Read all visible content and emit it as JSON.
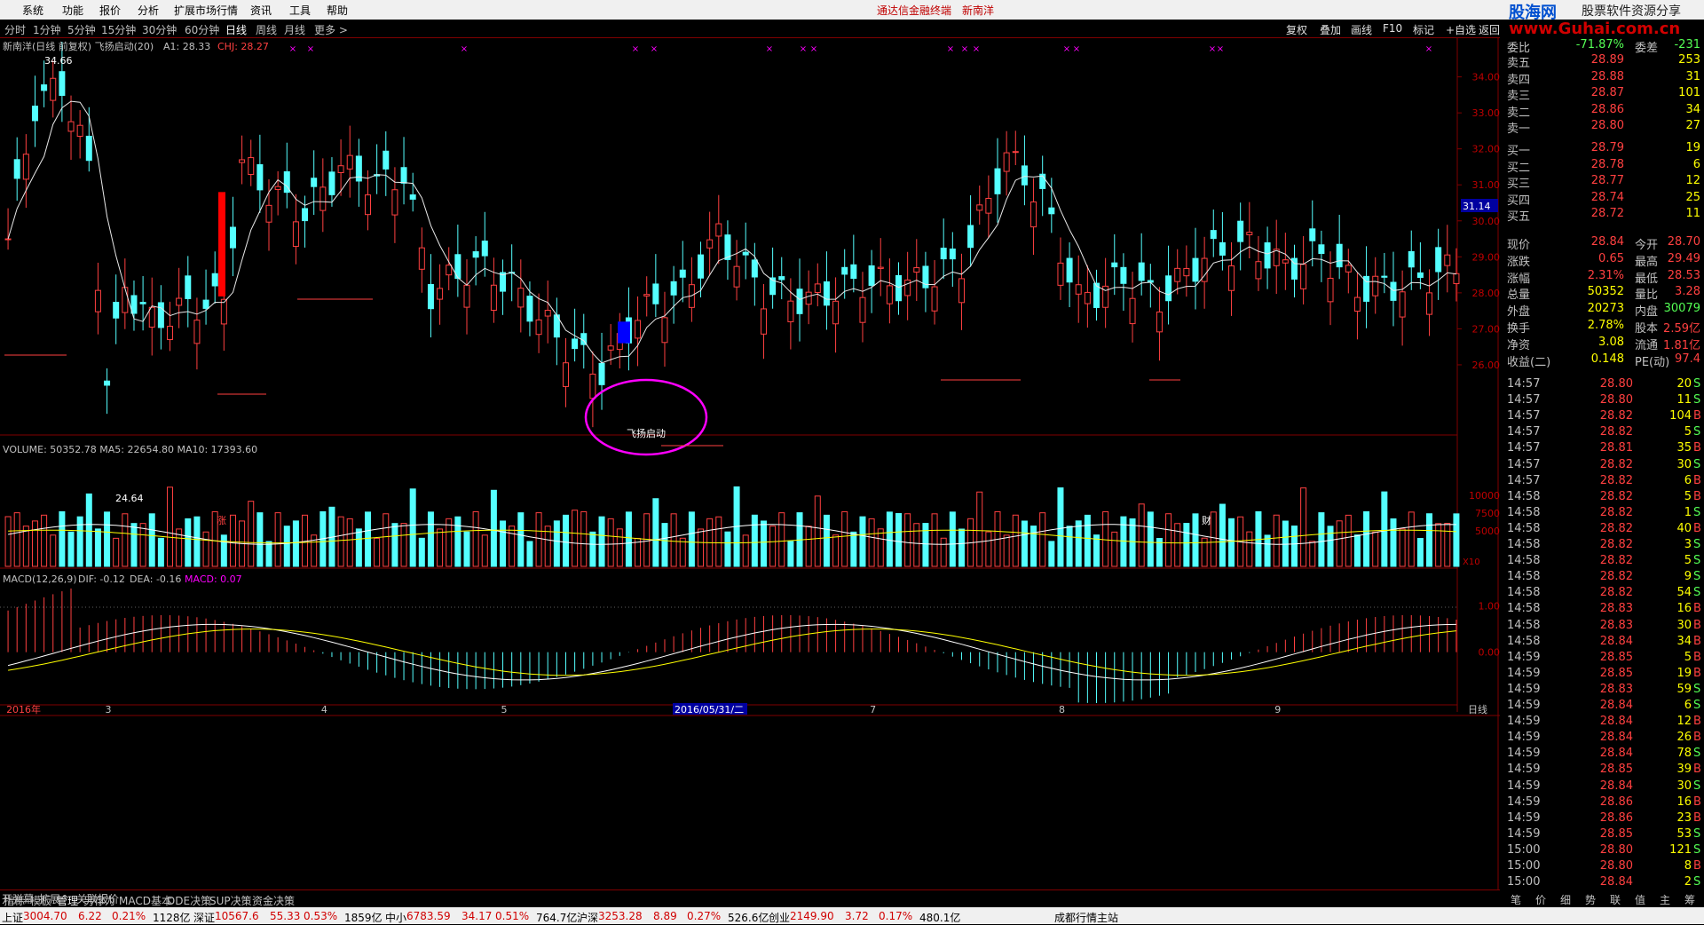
{
  "menu": [
    "系统",
    "功能",
    "报价",
    "分析",
    "扩展市场行情",
    "资讯",
    "工具",
    "帮助"
  ],
  "app_title": "通达信金融终端",
  "stock_title": "新南洋",
  "brand": {
    "name1": "股海网",
    "name2": "股票软件资源分享",
    "url": "www.Guhai.com.cn"
  },
  "periods": [
    "分时",
    "1分钟",
    "5分钟",
    "15分钟",
    "30分钟",
    "60分钟",
    "日线",
    "周线",
    "月线",
    "更多 >"
  ],
  "active_period": "日线",
  "toolbar": [
    "复权",
    "叠加",
    "画线",
    "F10",
    "标记",
    "+自选",
    "返回"
  ],
  "indicator_title": {
    "main": "新南洋(日线 前复权) 飞扬启动(20)",
    "a1": "A1: 28.33",
    "chj": "CHJ: 28.27",
    "volume": "VOLUME: 50352.78  MA5: 22654.80  MA10: 17393.60",
    "macd_name": "MACD(12,26,9)",
    "macd_dif": "DIF: -0.12",
    "macd_dea": "DEA: -0.16",
    "macd_val": "MACD: 0.07"
  },
  "annotations": {
    "high": "34.66",
    "low": "24.64",
    "signal": "飞扬启动",
    "zhang": "涨",
    "cai": "财",
    "x10": "X10",
    "crosshair_price": "31.14",
    "cursor_date": "2016/05/31/二",
    "rix": "日线"
  },
  "chart_data": [
    {
      "type": "candlestick",
      "price_axis": {
        "ticks": [
          34.0,
          33.0,
          32.0,
          31.0,
          30.0,
          29.0,
          28.0,
          27.0,
          26.0
        ],
        "range": [
          24.1,
          35.1
        ]
      },
      "x_axis_labels": [
        {
          "label": "2016年",
          "index": 0
        },
        {
          "label": "3",
          "index": 11
        },
        {
          "label": "4",
          "index": 35
        },
        {
          "label": "5",
          "index": 55
        },
        {
          "label": "6",
          "index": 75
        },
        {
          "label": "7",
          "index": 96
        },
        {
          "label": "8",
          "index": 117
        },
        {
          "label": "9",
          "index": 141
        }
      ],
      "high": 34.66,
      "low": 24.64
    },
    {
      "type": "bar",
      "name": "VOLUME",
      "axis_ticks": [
        10000,
        7500,
        5000
      ],
      "range": [
        0,
        17500
      ]
    },
    {
      "type": "bar",
      "name": "MACD",
      "axis_ticks": [
        1.0,
        0.0
      ],
      "range": [
        -1.1,
        1.7
      ]
    }
  ],
  "quote": {
    "wei": {
      "label": "委比",
      "val": "-71.87%",
      "label2": "委差",
      "val2": "-231"
    },
    "sell": [
      {
        "l": "卖五",
        "p": "28.89",
        "v": "253"
      },
      {
        "l": "卖四",
        "p": "28.88",
        "v": "31"
      },
      {
        "l": "卖三",
        "p": "28.87",
        "v": "101"
      },
      {
        "l": "卖二",
        "p": "28.86",
        "v": "34"
      },
      {
        "l": "卖一",
        "p": "28.80",
        "v": "27"
      }
    ],
    "buy": [
      {
        "l": "买一",
        "p": "28.79",
        "v": "19"
      },
      {
        "l": "买二",
        "p": "28.78",
        "v": "6"
      },
      {
        "l": "买三",
        "p": "28.77",
        "v": "12"
      },
      {
        "l": "买四",
        "p": "28.74",
        "v": "25"
      },
      {
        "l": "买五",
        "p": "28.72",
        "v": "11"
      }
    ],
    "stats": [
      [
        "现价",
        "28.84",
        "今开",
        "28.70"
      ],
      [
        "涨跌",
        "0.65",
        "最高",
        "29.49"
      ],
      [
        "涨幅",
        "2.31%",
        "最低",
        "28.53"
      ],
      [
        "总量",
        "50352",
        "量比",
        "3.28"
      ],
      [
        "外盘",
        "20273",
        "内盘",
        "30079"
      ],
      [
        "换手",
        "2.78%",
        "股本",
        "2.59亿"
      ],
      [
        "净资",
        "3.08",
        "流通",
        "1.81亿"
      ],
      [
        "收益(二)",
        "0.148",
        "PE(动)",
        "97.4"
      ]
    ],
    "ticks": [
      [
        "14:57",
        "28.80",
        "20",
        "S"
      ],
      [
        "14:57",
        "28.80",
        "11",
        "S"
      ],
      [
        "14:57",
        "28.82",
        "104",
        "B"
      ],
      [
        "14:57",
        "28.82",
        "5",
        "S"
      ],
      [
        "14:57",
        "28.81",
        "35",
        "B"
      ],
      [
        "14:57",
        "28.82",
        "30",
        "S"
      ],
      [
        "14:57",
        "28.82",
        "6",
        "B"
      ],
      [
        "14:58",
        "28.82",
        "5",
        "B"
      ],
      [
        "14:58",
        "28.82",
        "1",
        "S"
      ],
      [
        "14:58",
        "28.82",
        "40",
        "B"
      ],
      [
        "14:58",
        "28.82",
        "3",
        "S"
      ],
      [
        "14:58",
        "28.82",
        "5",
        "S"
      ],
      [
        "14:58",
        "28.82",
        "9",
        "S"
      ],
      [
        "14:58",
        "28.82",
        "54",
        "S"
      ],
      [
        "14:58",
        "28.83",
        "16",
        "B"
      ],
      [
        "14:58",
        "28.83",
        "30",
        "B"
      ],
      [
        "14:58",
        "28.84",
        "34",
        "B"
      ],
      [
        "14:59",
        "28.85",
        "5",
        "B"
      ],
      [
        "14:59",
        "28.85",
        "19",
        "B"
      ],
      [
        "14:59",
        "28.83",
        "59",
        "S"
      ],
      [
        "14:59",
        "28.84",
        "6",
        "S"
      ],
      [
        "14:59",
        "28.84",
        "12",
        "B"
      ],
      [
        "14:59",
        "28.84",
        "26",
        "B"
      ],
      [
        "14:59",
        "28.84",
        "78",
        "S"
      ],
      [
        "14:59",
        "28.85",
        "39",
        "B"
      ],
      [
        "14:59",
        "28.84",
        "30",
        "S"
      ],
      [
        "14:59",
        "28.86",
        "16",
        "B"
      ],
      [
        "14:59",
        "28.86",
        "23",
        "B"
      ],
      [
        "14:59",
        "28.85",
        "53",
        "S"
      ],
      [
        "15:00",
        "28.80",
        "121",
        "S"
      ],
      [
        "15:00",
        "28.80",
        "8",
        "B"
      ],
      [
        "15:00",
        "28.84",
        "2",
        "S"
      ]
    ]
  },
  "bottom_tabs": [
    "指标",
    "模板",
    "管理",
    "另存为",
    "MACD基本",
    "DDE决策",
    "SUP决策",
    "资金决策"
  ],
  "bottom_tabs2": [
    "开弹幕",
    "扩展^",
    "关联报价"
  ],
  "quote_tabs": [
    "笔",
    "价",
    "细",
    "势",
    "联",
    "值",
    "主",
    "筹"
  ],
  "status": [
    {
      "n": "上证",
      "v": "3004.70",
      "c": "6.22",
      "p": "0.21%",
      "a": "1128亿"
    },
    {
      "n": "深证",
      "v": "10567.6",
      "c": "55.33",
      "p": "0.53%",
      "a": "1859亿"
    },
    {
      "n": "中小",
      "v": "6783.59",
      "c": "34.17",
      "p": "0.51%",
      "a": "764.7亿"
    },
    {
      "n": "沪深",
      "v": "3253.28",
      "c": "8.89",
      "p": "0.27%",
      "a": "526.6亿"
    },
    {
      "n": "创业",
      "v": "2149.90",
      "c": "3.72",
      "p": "0.17%",
      "a": "480.1亿"
    }
  ],
  "status_site": "成都行情主站",
  "colors": {
    "up": "#ff4040",
    "down": "#54ffff",
    "ma": "#e8e8e8",
    "grid": "#800000",
    "macd_dif": "#ffffff",
    "macd_dea": "#ffff00",
    "highlight": "#ff00ff"
  }
}
